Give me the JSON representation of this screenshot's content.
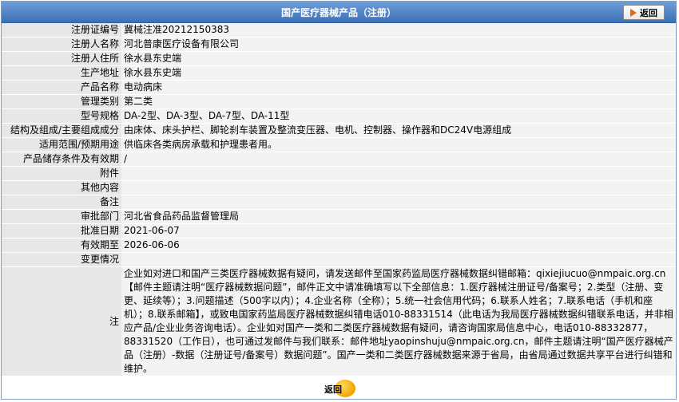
{
  "header": {
    "title": "国产医疗器械产品（注册）",
    "back_label": "返回"
  },
  "rows": [
    {
      "label": "注册证编号",
      "value": "冀械注准20212150383"
    },
    {
      "label": "注册人名称",
      "value": "河北普康医疗设备有限公司"
    },
    {
      "label": "注册人住所",
      "value": "徐水县东史端"
    },
    {
      "label": "生产地址",
      "value": "徐水县东史端"
    },
    {
      "label": "产品名称",
      "value": "电动病床"
    },
    {
      "label": "管理类别",
      "value": "第二类"
    },
    {
      "label": "型号规格",
      "value": "DA-2型、DA-3型、DA-7型、DA-11型"
    },
    {
      "label": "结构及组成/主要组成成分",
      "value": "由床体、床头护栏、脚轮刹车装置及整流变压器、电机、控制器、操作器和DC24V电源组成"
    },
    {
      "label": "适用范围/预期用途",
      "value": "供临床各类病房承载和护理患者用。"
    },
    {
      "label": "产品储存条件及有效期",
      "value": "/"
    },
    {
      "label": "附件",
      "value": ""
    },
    {
      "label": "其他内容",
      "value": ""
    },
    {
      "label": "备注",
      "value": ""
    },
    {
      "label": "审批部门",
      "value": "河北省食品药品监督管理局"
    },
    {
      "label": "批准日期",
      "value": "2021-06-07"
    },
    {
      "label": "有效期至",
      "value": "2026-06-06"
    },
    {
      "label": "变更情况",
      "value": ""
    }
  ],
  "note": {
    "label": "注",
    "text": "企业如对进口和国产三类医疗器械数据有疑问，请发送邮件至国家药监局医疗器械数据纠错邮箱：qixiejiucuo@nmpaic.org.cn【邮件主题请注明“医疗器械数据问题”，邮件正文中请准确填写以下全部信息：1.医疗器械注册证号/备案号；2.类型（注册、变更、延续等）；3.问题描述（500字以内）；4.企业名称（全称）；5.统一社会信用代码；6.联系人姓名；7.联系电话（手机和座机）；8.联系邮箱】，或致电国家药监局医疗器械数据纠错电话010-88331514（此电话为我局医疗器械数据纠错联系电话，并非相应产品/企业业务咨询电话）。企业如对国产一类和二类医疗器械数据有疑问，请咨询国家局信息中心，电话010-88332877，88331520（工作日），也可通过发邮件与我们联系：邮件地址yaopinshuju@nmpaic.org.cn，邮件主题请注明“国产医疗器械产品（注册）-数据（注册证号/备案号）数据问题”。国产一类和二类医疗器械数据来源于省局，由省局通过数据共享平台进行纠错和维护。"
  },
  "footer": {
    "back_label": "返回"
  }
}
